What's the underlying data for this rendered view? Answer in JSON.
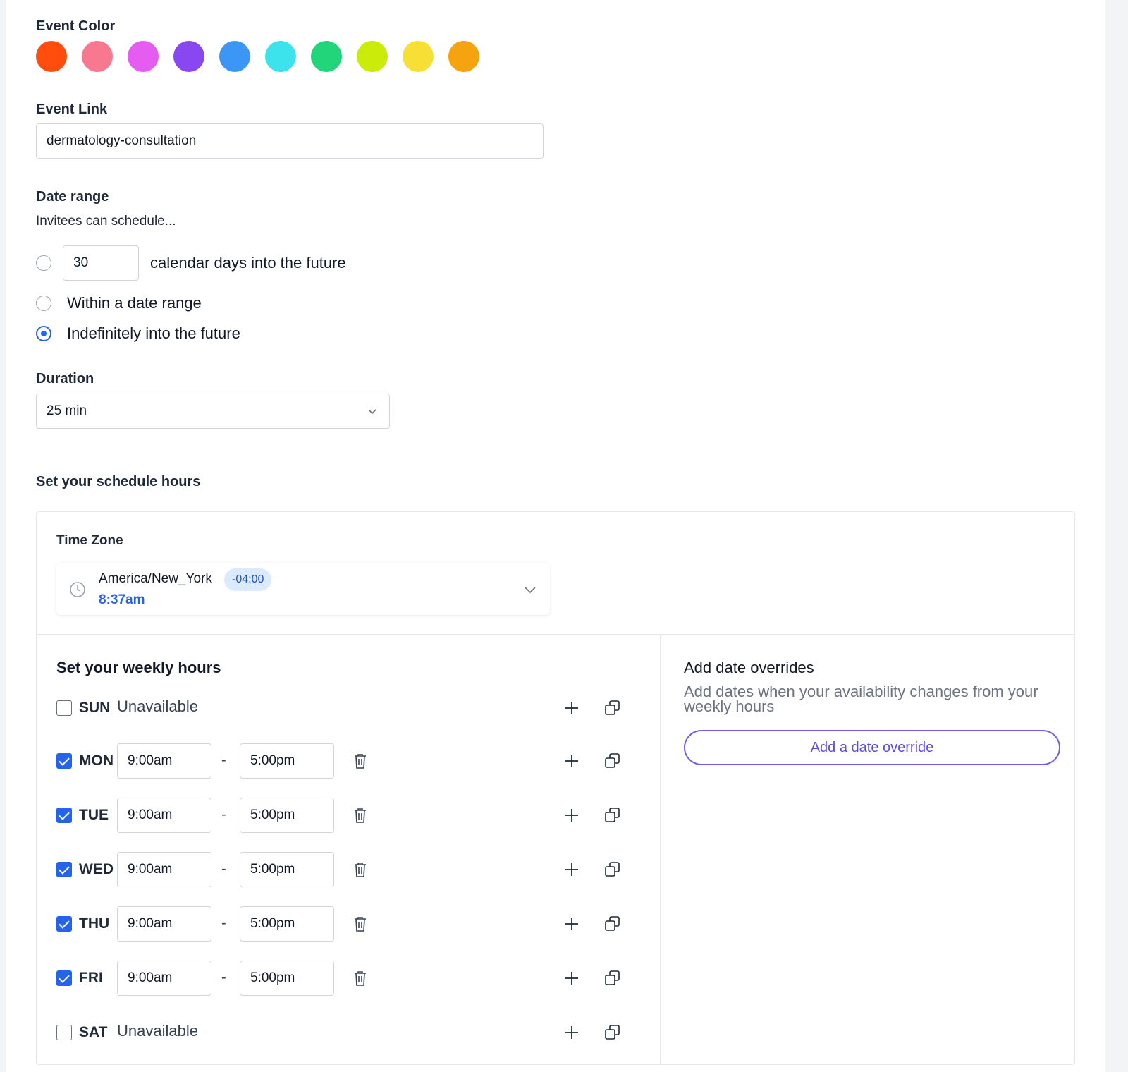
{
  "event_color": {
    "label": "Event Color",
    "colors": [
      "#ff4d0d",
      "#f7788f",
      "#e55cf0",
      "#8847f0",
      "#3b96f5",
      "#3de3ec",
      "#22d47a",
      "#cbeb0a",
      "#f7df36",
      "#f5a30f"
    ]
  },
  "event_link": {
    "label": "Event Link",
    "value": "dermatology-consultation"
  },
  "date_range": {
    "label": "Date range",
    "sublabel": "Invitees can schedule...",
    "days_value": "30",
    "options": [
      "calendar days into the future",
      "Within a date range",
      "Indefinitely into the future"
    ],
    "selected_index": 2
  },
  "duration": {
    "label": "Duration",
    "value": "25 min"
  },
  "schedule": {
    "title": "Set your schedule hours",
    "timezone": {
      "label": "Time Zone",
      "name": "America/New_York",
      "offset": "-04:00",
      "current_time": "8:37am"
    },
    "weekly": {
      "title": "Set your weekly hours",
      "unavailable_text": "Unavailable",
      "separator": "-",
      "days": [
        {
          "day": "SUN",
          "enabled": false
        },
        {
          "day": "MON",
          "enabled": true,
          "start": "9:00am",
          "end": "5:00pm"
        },
        {
          "day": "TUE",
          "enabled": true,
          "start": "9:00am",
          "end": "5:00pm"
        },
        {
          "day": "WED",
          "enabled": true,
          "start": "9:00am",
          "end": "5:00pm"
        },
        {
          "day": "THU",
          "enabled": true,
          "start": "9:00am",
          "end": "5:00pm"
        },
        {
          "day": "FRI",
          "enabled": true,
          "start": "9:00am",
          "end": "5:00pm"
        },
        {
          "day": "SAT",
          "enabled": false
        }
      ]
    },
    "overrides": {
      "title": "Add date overrides",
      "description": "Add dates when your availability changes from your weekly hours",
      "button_label": "Add a date override"
    }
  }
}
